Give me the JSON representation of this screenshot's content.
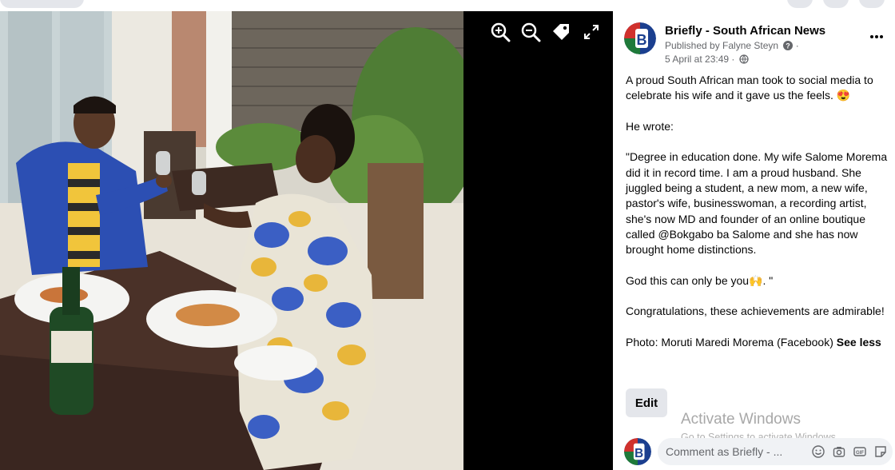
{
  "post": {
    "page_name": "Briefly - South African News",
    "published_by": "Published by Falyne Steyn",
    "timestamp": "5 April at 23:49 ·",
    "paragraphs": [
      "A proud South African man took to social media to celebrate his wife and it gave us the feels. 😍",
      "He wrote:",
      "\"Degree in education done. My wife Salome Morema did it in record time. I am a proud husband. She juggled being a student, a new mom, a new wife, pastor's wife, businesswoman, a recording artist, she's now MD and founder of an online boutique called @Bokgabo ba Salome and she has now brought home distinctions.",
      "God this can only be you🙌. \"",
      "Congratulations, these achievements are admirable!"
    ],
    "photo_credit": "Photo: Moruti Maredi Morema (Facebook) ",
    "see_less": "See less",
    "edit_label": "Edit"
  },
  "comment": {
    "placeholder": "Comment as Briefly - ..."
  },
  "watermark": {
    "title": "Activate Windows",
    "subtitle": "Go to Settings to activate Windows."
  },
  "icons": {
    "zoom_in": "zoom-in-icon",
    "zoom_out": "zoom-out-icon",
    "tag": "tag-icon",
    "fullscreen": "fullscreen-icon",
    "more": "more-options-icon",
    "globe": "globe-icon",
    "info": "info-icon"
  },
  "colors": {
    "brand_flag_green": "#1f7a3a",
    "brand_flag_red": "#d0312d",
    "brand_flag_blue": "#1b3f8f",
    "text_secondary": "#65676b"
  }
}
